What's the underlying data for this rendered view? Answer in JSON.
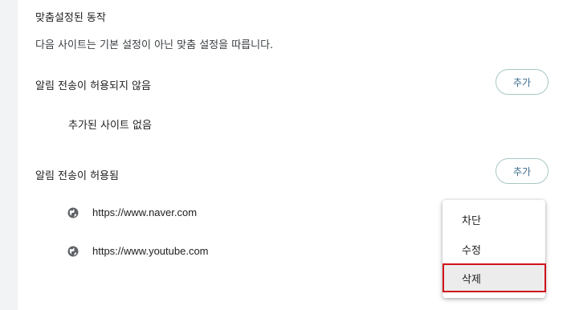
{
  "section": {
    "title": "맞춤설정된 동작",
    "description": "다음 사이트는 기본 설정이 아닌 맞춤 설정을 따릅니다."
  },
  "blocked": {
    "label": "알림 전송이 허용되지 않음",
    "add_label": "추가",
    "empty_text": "추가된 사이트 없음"
  },
  "allowed": {
    "label": "알림 전송이 허용됨",
    "add_label": "추가",
    "sites": [
      {
        "url": "https://www.naver.com",
        "icon": "globe-icon"
      },
      {
        "url": "https://www.youtube.com",
        "icon": "globe-icon"
      }
    ]
  },
  "context_menu": {
    "items": [
      {
        "label": "차단"
      },
      {
        "label": "수정"
      },
      {
        "label": "삭제",
        "highlighted": true
      }
    ],
    "highlight_color": "#d0121b"
  }
}
